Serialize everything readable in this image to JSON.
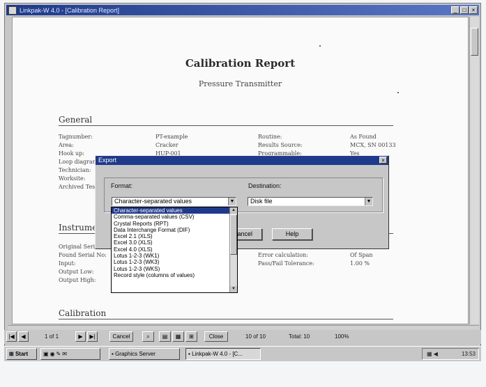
{
  "window": {
    "title": "Linkpak-W 4.0 - [Calibration Report]",
    "buttons": [
      "_",
      "□",
      "×"
    ]
  },
  "report": {
    "title": "Calibration Report",
    "subtitle": "Pressure Transmitter",
    "sections": {
      "general": "General",
      "instrument": "Instrument",
      "calibration": "Calibration"
    },
    "general_left_labels": [
      "Tagnumber:",
      "Area:",
      "Hook up:",
      "Loop diagram:",
      "Technician:",
      "Worksite:",
      "Archived Tests:"
    ],
    "general_left_values": [
      "PT-example",
      "Cracker",
      "HUP-001"
    ],
    "general_right_labels": [
      "Routine:",
      "Results Source:",
      "Programmable:"
    ],
    "general_right_values": [
      "As Found",
      "MCX, SN 00133",
      "Yes"
    ],
    "instrument_labels": [
      "Original Serial:",
      "Found Serial No:",
      "Input:",
      "Output Low:",
      "Output High:"
    ],
    "instrument_right_labels": [
      "Error calculation:",
      "Pass/Fail Tolerance:"
    ],
    "instrument_right_values": [
      "Of Span",
      "1.00 %"
    ]
  },
  "export_dialog": {
    "title": "Export",
    "close": "×",
    "format_label": "Format:",
    "format_value": "Character-separated values",
    "destination_label": "Destination:",
    "destination_value": "Disk file",
    "cancel_label": "Cancel",
    "help_label": "Help",
    "format_options": [
      "Character-separated values",
      "Comma-separated values (CSV)",
      "Crystal Reports (RPT)",
      "Data Interchange Format (DIF)",
      "Excel 2.1 (XLS)",
      "Excel 3.0 (XLS)",
      "Excel 4.0 (XLS)",
      "Lotus 1-2-3 (WK1)",
      "Lotus 1-2-3 (WK3)",
      "Lotus 1-2-3 (WKS)",
      "Record style (columns of values)"
    ],
    "selected_index": 0
  },
  "viewer_toolbar": {
    "page_text": "1 of 1",
    "cancel_label": "Cancel",
    "close_label": "Close",
    "records_text": "10 of 10",
    "total_text": "Total: 10",
    "zoom_text": "100%"
  },
  "taskbar": {
    "start_label": "Start",
    "tasks": [
      "Graphics Server",
      "Linkpak-W 4.0 - [C..."
    ],
    "clock": "13:53"
  }
}
